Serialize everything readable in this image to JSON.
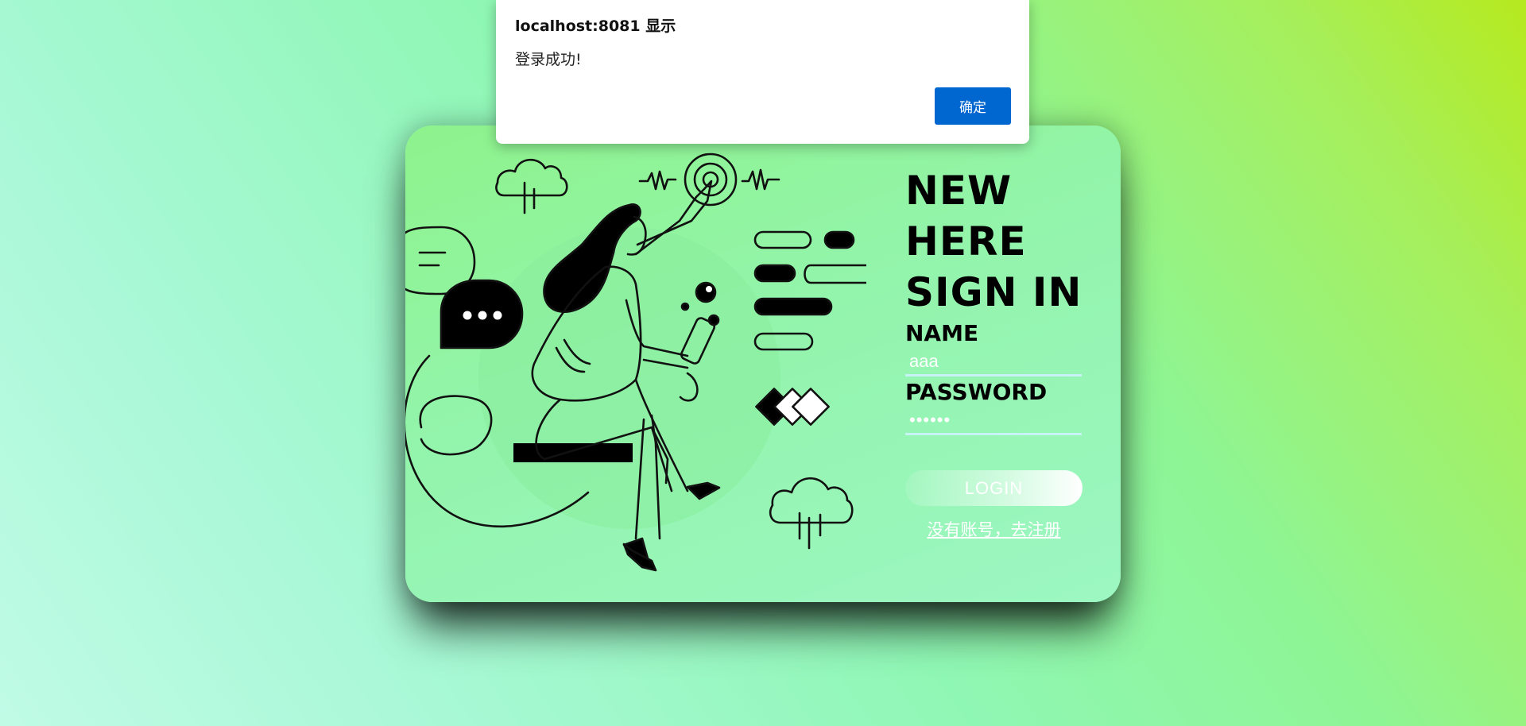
{
  "page": {
    "background_colors": [
      "#c0fbe6",
      "#8ff7b4",
      "#b6ea1e"
    ]
  },
  "login_card": {
    "heading_lines": [
      "NEW",
      "HERE",
      "SIGN IN"
    ],
    "name_label": "NAME",
    "name_value": "aaa",
    "password_label": "PASSWORD",
    "password_value": "••••••",
    "login_button": "LOGIN",
    "register_link": "没有账号，去注册",
    "card_color": "#93f4ac"
  },
  "alert": {
    "title": "localhost:8081 显示",
    "message": "登录成功!",
    "ok_button": "确定",
    "accent_color": "#0067d1"
  },
  "illustration": {
    "icons": [
      "cloud-rain-icon",
      "chat-bubble-icon",
      "touch-ripple-icon",
      "pills-icon",
      "diamonds-icon",
      "woman-figure"
    ]
  }
}
